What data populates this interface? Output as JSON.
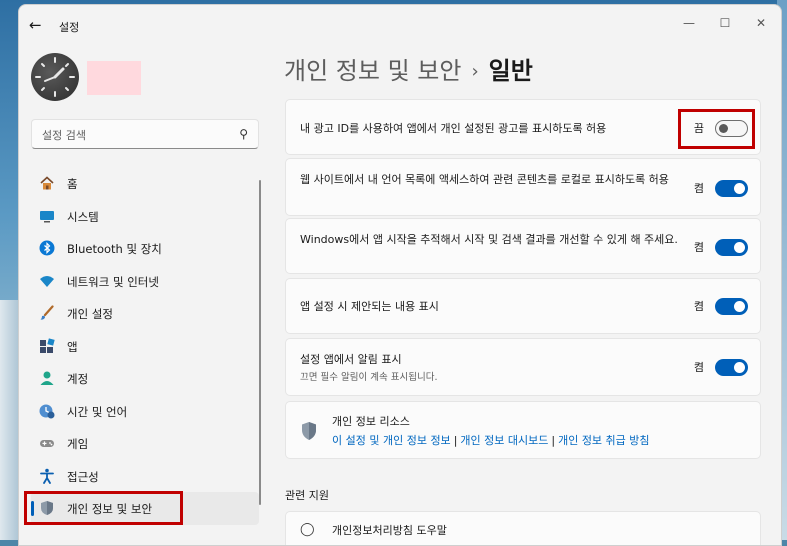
{
  "window": {
    "title": "설정",
    "back_icon": "back-arrow-icon",
    "controls": {
      "minimize": "—",
      "maximize": "☐",
      "close": "✕"
    }
  },
  "search": {
    "placeholder": "설정 검색",
    "icon": "search-icon"
  },
  "sidebar": {
    "items": [
      {
        "label": "홈",
        "icon": "home-icon",
        "selected": false
      },
      {
        "label": "시스템",
        "icon": "system-icon",
        "selected": false
      },
      {
        "label": "Bluetooth 및 장치",
        "icon": "bluetooth-icon",
        "selected": false
      },
      {
        "label": "네트워크 및 인터넷",
        "icon": "wifi-icon",
        "selected": false
      },
      {
        "label": "개인 설정",
        "icon": "brush-icon",
        "selected": false
      },
      {
        "label": "앱",
        "icon": "apps-icon",
        "selected": false
      },
      {
        "label": "계정",
        "icon": "account-icon",
        "selected": false
      },
      {
        "label": "시간 및 언어",
        "icon": "time-language-icon",
        "selected": false
      },
      {
        "label": "게임",
        "icon": "gaming-icon",
        "selected": false
      },
      {
        "label": "접근성",
        "icon": "accessibility-icon",
        "selected": false
      },
      {
        "label": "개인 정보 및 보안",
        "icon": "shield-icon",
        "selected": true
      }
    ]
  },
  "breadcrumb": {
    "parent": "개인 정보 및 보안",
    "separator": "›",
    "current": "일반"
  },
  "settings": [
    {
      "label": "내 광고 ID를 사용하여 앱에서 개인 설정된 광고를 표시하도록 허용",
      "state": "끔",
      "on": false
    },
    {
      "label": "웹 사이트에서 내 언어 목록에 액세스하여 관련 콘텐츠를 로컬로 표시하도록 허용",
      "state": "켬",
      "on": true
    },
    {
      "label": "Windows에서 앱 시작을 추적해서 시작 및 검색 결과를 개선할 수 있게 해 주세요.",
      "state": "켬",
      "on": true
    },
    {
      "label": "앱 설정 시 제안되는 내용 표시",
      "state": "켬",
      "on": true
    },
    {
      "label": "설정 앱에서 알림 표시",
      "sub": "끄면 필수 알림이 계속 표시됩니다.",
      "state": "켬",
      "on": true
    }
  ],
  "resources": {
    "title": "개인 정보 리소스",
    "links": [
      "이 설정 및 개인 정보 정보",
      "개인 정보 대시보드",
      "개인 정보 취급 방침"
    ]
  },
  "related": {
    "heading": "관련 지원",
    "first_item": "개인정보처리방침 도우말"
  },
  "colors": {
    "accent": "#005fb8",
    "link": "#0067c0",
    "highlight_box": "#c00000"
  }
}
